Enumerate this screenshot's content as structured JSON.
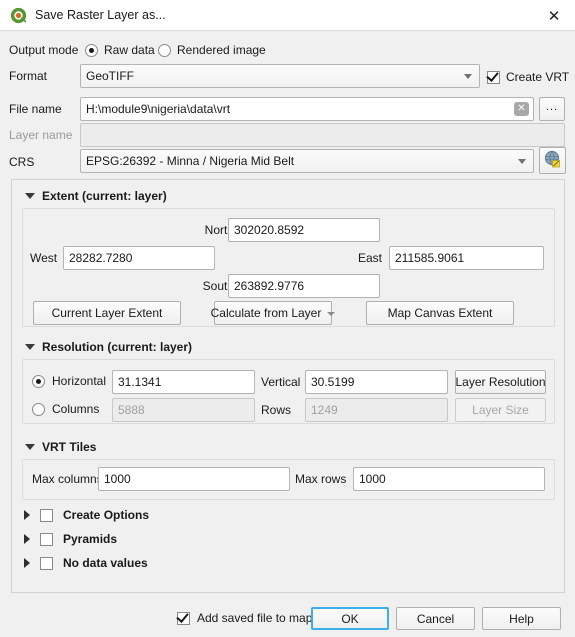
{
  "window": {
    "title": "Save Raster Layer as...",
    "app_icon": "qgis-logo-icon",
    "close_icon": "close-icon"
  },
  "output_mode": {
    "label": "Output mode",
    "options": [
      {
        "label": "Raw data",
        "selected": true
      },
      {
        "label": "Rendered image",
        "selected": false
      }
    ]
  },
  "format": {
    "label": "Format",
    "value": "GeoTIFF",
    "create_vrt_label": "Create VRT",
    "create_vrt_checked": true
  },
  "file_name": {
    "label": "File name",
    "value": "H:\\module9\\nigeria\\data\\vrt",
    "clear_icon": "clear-x-icon",
    "browse_label": "..."
  },
  "layer_name": {
    "label": "Layer name",
    "value": "",
    "placeholder": "",
    "disabled": true
  },
  "crs": {
    "label": "CRS",
    "value": "EPSG:26392 - Minna / Nigeria Mid Belt",
    "select_icon": "globe-crs-icon"
  },
  "extent": {
    "title": "Extent (current: layer)",
    "expanded": true,
    "north_label": "North",
    "north_value": "302020.8592",
    "west_label": "West",
    "west_value": "28282.7280",
    "east_label": "East",
    "east_value": "211585.9061",
    "south_label": "South",
    "south_value": "263892.9776",
    "buttons": {
      "current_layer_extent": "Current Layer Extent",
      "calculate_from_layer": "Calculate from Layer",
      "map_canvas_extent": "Map Canvas Extent"
    }
  },
  "resolution": {
    "title": "Resolution (current: layer)",
    "expanded": true,
    "horizontal_label": "Horizontal",
    "horizontal_selected": true,
    "horizontal_value": "31.1341",
    "vertical_label": "Vertical",
    "vertical_value": "30.5199",
    "layer_resolution_label": "Layer Resolution",
    "columns_label": "Columns",
    "columns_selected": false,
    "columns_value": "5888",
    "rows_label": "Rows",
    "rows_value": "1249",
    "layer_size_label": "Layer Size"
  },
  "vrt_tiles": {
    "title": "VRT Tiles",
    "expanded": true,
    "max_columns_label": "Max columns",
    "max_columns_value": "1000",
    "max_rows_label": "Max rows",
    "max_rows_value": "1000"
  },
  "collapsed_sections": [
    {
      "label": "Create Options",
      "checked": false
    },
    {
      "label": "Pyramids",
      "checked": false
    },
    {
      "label": "No data values",
      "checked": false
    }
  ],
  "footer": {
    "add_saved_file_label": "Add saved file to map",
    "add_saved_file_checked": true,
    "ok_label": "OK",
    "cancel_label": "Cancel",
    "help_label": "Help"
  },
  "colors": {
    "accent": "#3daee9",
    "dialog_bg": "#f0f0f0",
    "field_bg": "#ffffff",
    "qgis_green": "#93b023"
  }
}
